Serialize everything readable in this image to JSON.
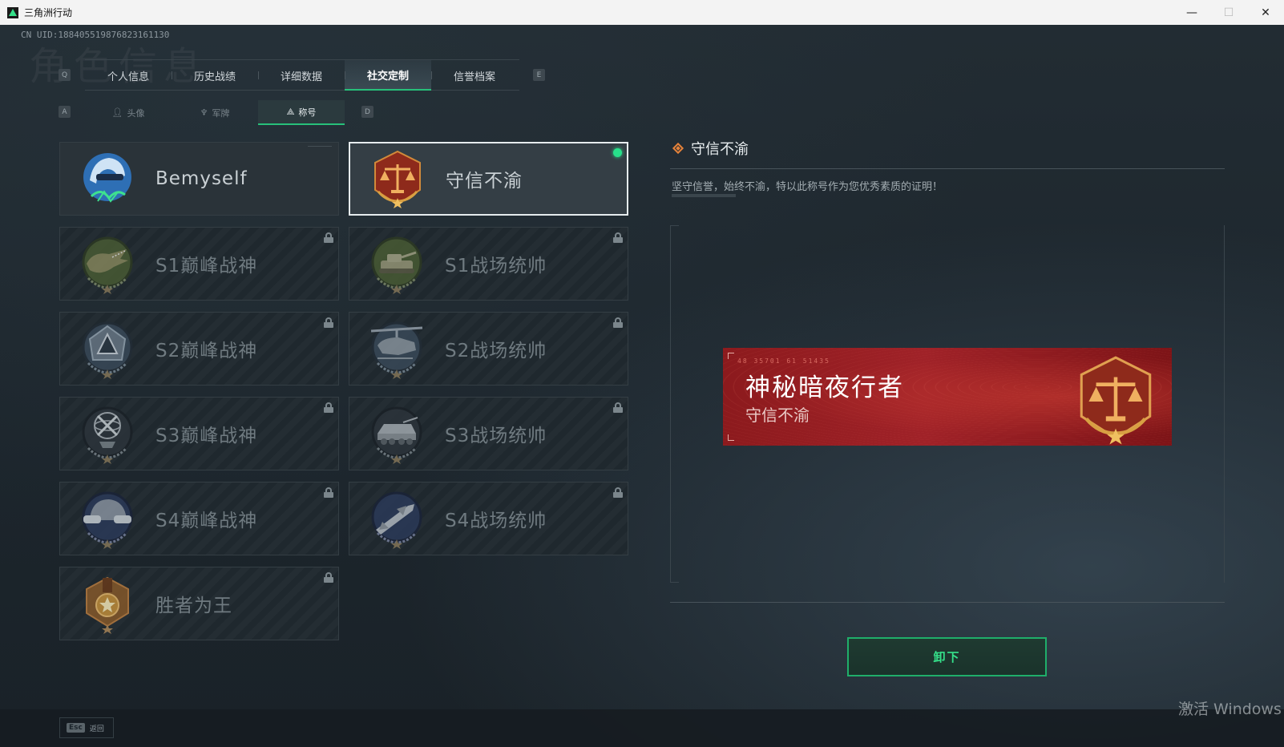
{
  "window": {
    "title": "三角洲行动",
    "minimize": "—",
    "maximize": "☐",
    "close": "✕"
  },
  "uid": "CN UID:188405519876823161130",
  "watermark": "角色信息",
  "tabs": {
    "prev_key": "Q",
    "next_key": "E",
    "items": [
      {
        "label": "个人信息"
      },
      {
        "label": "历史战绩"
      },
      {
        "label": "详细数据"
      },
      {
        "label": "社交定制",
        "active": true
      },
      {
        "label": "信誉档案"
      }
    ]
  },
  "subtabs": {
    "prev_key": "A",
    "next_key": "D",
    "items": [
      {
        "label": "头像",
        "icon": "person-icon"
      },
      {
        "label": "军牌",
        "icon": "dogtag-icon"
      },
      {
        "label": "称号",
        "icon": "title-icon",
        "active": true
      }
    ]
  },
  "titles": [
    {
      "label": "Bemyself",
      "state": "unlocked",
      "icon": "helmet-signature-badge"
    },
    {
      "label": "守信不渝",
      "state": "selected",
      "equipped": true,
      "icon": "scales-badge"
    },
    {
      "label": "S1巅峰战神",
      "state": "locked",
      "icon": "crocodile-badge"
    },
    {
      "label": "S1战场统帅",
      "state": "locked",
      "icon": "tank-badge"
    },
    {
      "label": "S2巅峰战神",
      "state": "locked",
      "icon": "delta-emblem-badge"
    },
    {
      "label": "S2战场统帅",
      "state": "locked",
      "icon": "helicopter-badge"
    },
    {
      "label": "S3巅峰战神",
      "state": "locked",
      "icon": "globe-badge"
    },
    {
      "label": "S3战场统帅",
      "state": "locked",
      "icon": "apc-badge"
    },
    {
      "label": "S4巅峰战神",
      "state": "locked",
      "icon": "nvg-helmet-badge"
    },
    {
      "label": "S4战场统帅",
      "state": "locked",
      "icon": "missile-badge"
    },
    {
      "label": "胜者为王",
      "state": "locked",
      "icon": "medal-badge"
    }
  ],
  "detail": {
    "title": "守信不渝",
    "description": "坚守信誉，始终不渝，特以此称号作为您优秀素质的证明！",
    "nameplate": {
      "code": "48 35701 61 51435",
      "player_name": "神秘暗夜行者",
      "title": "守信不渝"
    },
    "unequip_label": "卸下"
  },
  "bottom": {
    "esc_key": "Esc",
    "esc_label": "返回"
  },
  "os_watermark": "激活 Windows",
  "colors": {
    "accent": "#27c07a",
    "equipped_dot": "#27e08a",
    "nameplate_red": "#a02228",
    "badge_orange": "#e5823a"
  }
}
